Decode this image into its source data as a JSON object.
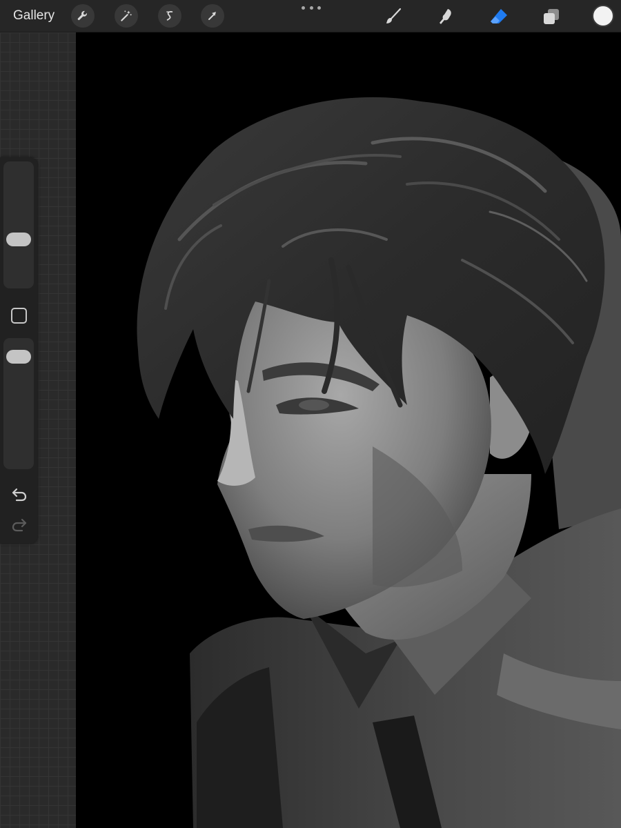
{
  "toolbar": {
    "gallery_label": "Gallery",
    "left_tools": [
      {
        "name": "actions",
        "icon": "wrench-icon"
      },
      {
        "name": "adjustments",
        "icon": "magic-wand-icon"
      },
      {
        "name": "selection",
        "icon": "selection-s-icon"
      },
      {
        "name": "transform",
        "icon": "arrow-cursor-icon"
      }
    ],
    "more_icon": "more-dots-icon",
    "right_tools": [
      {
        "name": "brush",
        "icon": "brush-icon",
        "active": false
      },
      {
        "name": "smudge",
        "icon": "smudge-icon",
        "active": false
      },
      {
        "name": "eraser",
        "icon": "eraser-icon",
        "active": true
      },
      {
        "name": "layers",
        "icon": "layers-icon",
        "active": false
      }
    ],
    "current_color": "#f2f2f2"
  },
  "sidebar": {
    "brush_size_level": 0.36,
    "opacity_level": 0.93,
    "modify_icon": "square-modify-icon",
    "undo_icon": "undo-icon",
    "redo_icon": "redo-icon"
  },
  "colors": {
    "toolbar_bg": "#262626",
    "active_tool": "#1f7bf0",
    "icon_default": "#d8d8d8",
    "canvas_bg": "#000000"
  }
}
